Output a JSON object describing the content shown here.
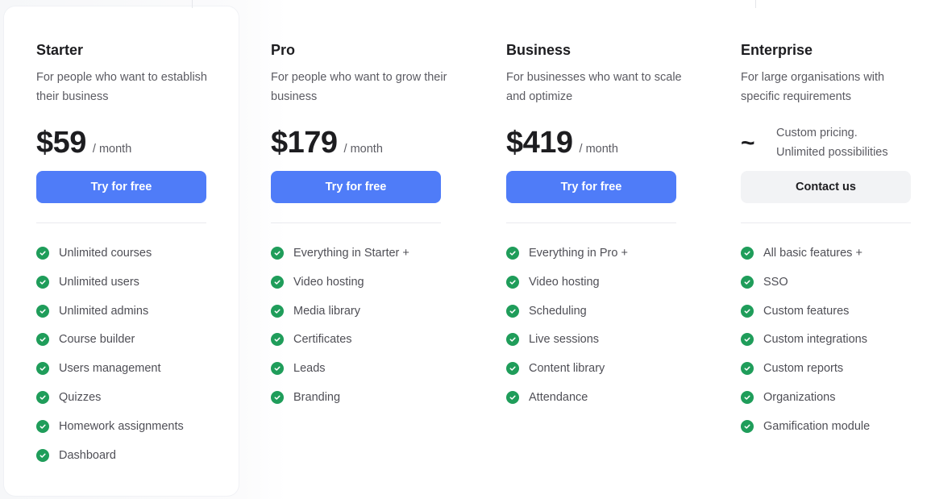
{
  "plans": [
    {
      "name": "Starter",
      "description": "For people who want to establish their business",
      "price": "$59",
      "period": "/ month",
      "cta": "Try for free",
      "features": [
        "Unlimited courses",
        "Unlimited users",
        "Unlimited admins",
        "Course builder",
        "Users management",
        "Quizzes",
        "Homework assignments",
        "Dashboard"
      ]
    },
    {
      "name": "Pro",
      "description": "For people who want to grow their business",
      "price": "$179",
      "period": "/ month",
      "cta": "Try for free",
      "features": [
        "Everything in Starter +",
        "Video hosting",
        "Media library",
        "Certificates",
        "Leads",
        "Branding"
      ]
    },
    {
      "name": "Business",
      "description": "For businesses who want to scale and optimize",
      "price": "$419",
      "period": "/ month",
      "cta": "Try for free",
      "features": [
        "Everything in Pro +",
        "Video hosting",
        "Scheduling",
        "Live sessions",
        "Content library",
        "Attendance"
      ]
    },
    {
      "name": "Enterprise",
      "description": "For large organisations with specific requirements",
      "price_symbol": "~",
      "custom_pricing_line1": "Custom pricing.",
      "custom_pricing_line2": "Unlimited possibilities",
      "cta": "Contact us",
      "features": [
        "All basic features +",
        "SSO",
        "Custom features",
        "Custom integrations",
        "Custom reports",
        "Organizations",
        "Gamification module"
      ]
    }
  ],
  "colors": {
    "primary_button": "#4f7cf8",
    "secondary_button": "#f2f3f5",
    "check": "#1f9d5a"
  },
  "icons": {
    "feature_check": "check-circle-icon"
  }
}
